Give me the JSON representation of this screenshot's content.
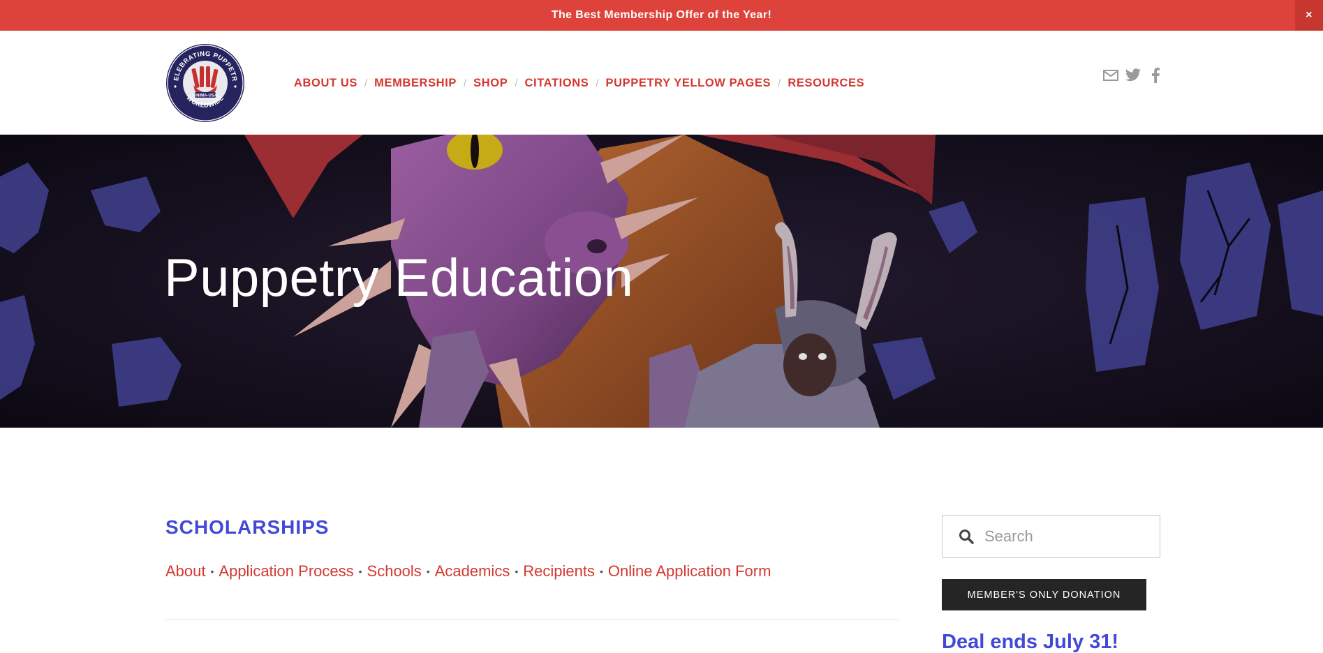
{
  "announcement": {
    "text": "The Best Membership Offer of the Year!",
    "close_label": "×"
  },
  "header": {
    "logo": {
      "top_text": "CELEBRATING PUPPETRY",
      "bottom_text": "WORLDWIDE",
      "badge_text": "UNIMA-USA"
    },
    "nav": [
      {
        "label": "ABOUT US"
      },
      {
        "label": "MEMBERSHIP"
      },
      {
        "label": "SHOP"
      },
      {
        "label": "CITATIONS"
      },
      {
        "label": "PUPPETRY YELLOW PAGES"
      },
      {
        "label": "RESOURCES"
      }
    ],
    "nav_separator": "/",
    "social_icons": [
      "mail-icon",
      "twitter-icon",
      "facebook-icon"
    ]
  },
  "hero": {
    "title": "Puppetry Education"
  },
  "main": {
    "section_title": "SCHOLARSHIPS",
    "sublinks": [
      {
        "label": "About"
      },
      {
        "label": "Application Process"
      },
      {
        "label": "Schools"
      },
      {
        "label": "Academics"
      },
      {
        "label": "Recipients"
      },
      {
        "label": "Online Application Form"
      }
    ],
    "sublink_separator": "•"
  },
  "sidebar": {
    "search": {
      "placeholder": "Search",
      "value": ""
    },
    "donate_label": "MEMBER'S ONLY DONATION",
    "deal_text": "Deal ends July 31!"
  },
  "colors": {
    "accent_red": "#de433b",
    "link_red": "#d4372f",
    "heading_blue": "#4149d6",
    "button_dark": "#252525",
    "logo_navy": "#26245e"
  }
}
